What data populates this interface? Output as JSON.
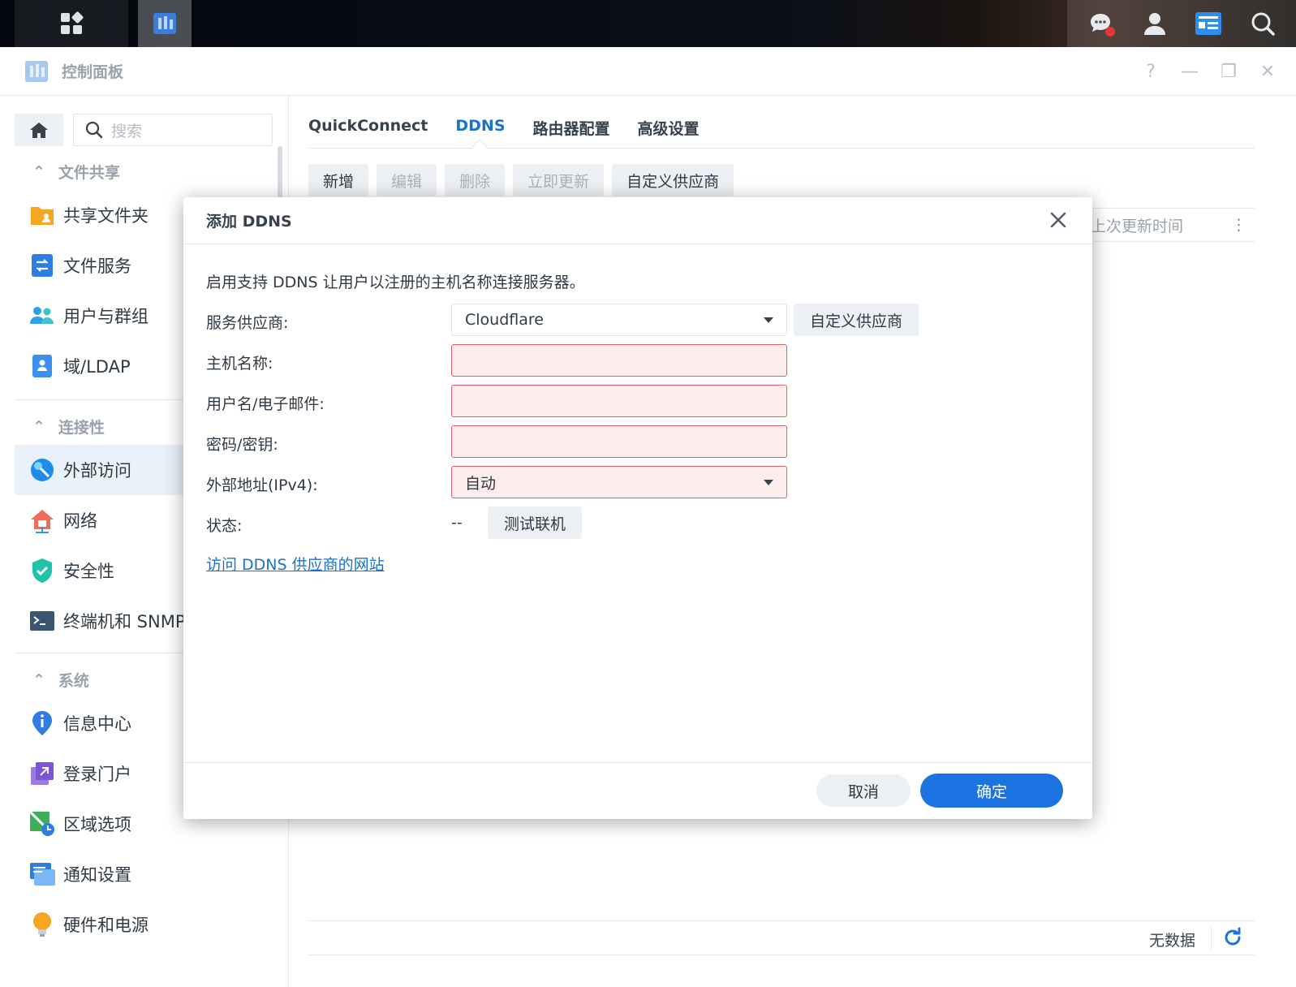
{
  "window": {
    "title": "控制面板",
    "controls": [
      "?",
      "—",
      "❐",
      "✕"
    ]
  },
  "sidebar": {
    "search_placeholder": "搜索",
    "sections": [
      {
        "label": "文件共享"
      },
      {
        "label": "连接性"
      },
      {
        "label": "系统"
      }
    ],
    "items": [
      {
        "label": "共享文件夹",
        "icon": "shared-folder-icon"
      },
      {
        "label": "文件服务",
        "icon": "file-services-icon"
      },
      {
        "label": "用户与群组",
        "icon": "users-groups-icon"
      },
      {
        "label": "域/LDAP",
        "icon": "domain-ldap-icon"
      },
      {
        "label": "外部访问",
        "icon": "external-access-icon",
        "active": true
      },
      {
        "label": "网络",
        "icon": "network-icon"
      },
      {
        "label": "安全性",
        "icon": "security-shield-icon"
      },
      {
        "label": "终端机和 SNMP",
        "icon": "terminal-icon"
      },
      {
        "label": "信息中心",
        "icon": "info-center-icon"
      },
      {
        "label": "登录门户",
        "icon": "login-portal-icon"
      },
      {
        "label": "区域选项",
        "icon": "regional-options-icon"
      },
      {
        "label": "通知设置",
        "icon": "notification-icon"
      },
      {
        "label": "硬件和电源",
        "icon": "hardware-power-icon"
      }
    ]
  },
  "main": {
    "tabs": [
      {
        "label": "QuickConnect"
      },
      {
        "label": "DDNS",
        "active": true
      },
      {
        "label": "路由器配置"
      },
      {
        "label": "高级设置"
      }
    ],
    "toolbar": {
      "add": "新增",
      "edit": "编辑",
      "delete": "删除",
      "update_now": "立即更新",
      "custom_provider": "自定义供应商"
    },
    "column_last_update": "上次更新时间",
    "no_data": "无数据"
  },
  "dialog": {
    "title": "添加 DDNS",
    "description": "启用支持 DDNS 让用户以注册的主机名称连接服务器。",
    "provider_label": "服务供应商:",
    "provider_value": "Cloudflare",
    "custom_provider_button": "自定义供应商",
    "hostname_label": "主机名称:",
    "username_label": "用户名/电子邮件:",
    "password_label": "密码/密钥:",
    "external_ip_label": "外部地址(IPv4):",
    "external_ip_value": "自动",
    "status_label": "状态:",
    "status_value": "--",
    "test_button": "测试联机",
    "visit_link": "访问 DDNS 供应商的网站",
    "cancel": "取消",
    "ok": "确定"
  },
  "colors": {
    "accent": "#1a73e0",
    "error_bg": "#fdecec",
    "error_border": "#e0606a",
    "notification_dot": "#e8333b"
  }
}
